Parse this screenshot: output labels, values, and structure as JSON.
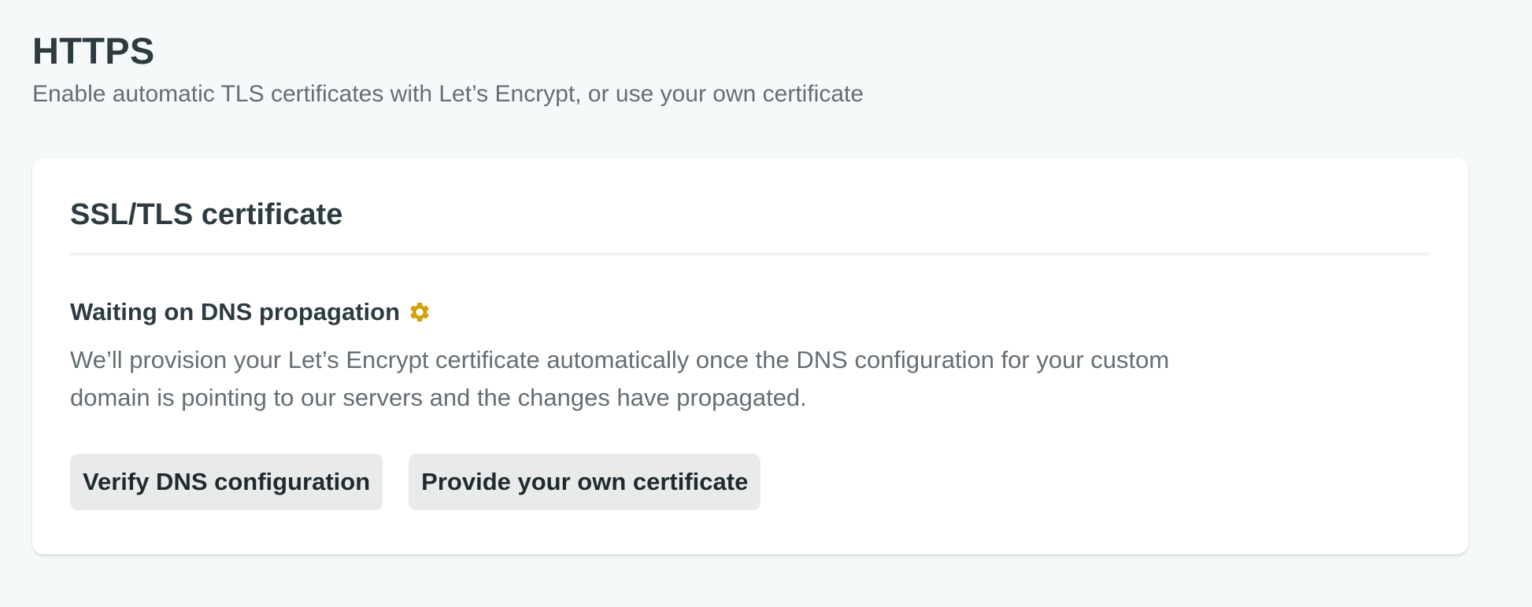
{
  "header": {
    "title": "HTTPS",
    "subtitle": "Enable automatic TLS certificates with Let’s Encrypt, or use your own certificate"
  },
  "card": {
    "title": "SSL/TLS certificate",
    "status": {
      "title": "Waiting on DNS propagation",
      "icon": "gear-icon",
      "icon_color": "#d3a10b",
      "description": "We’ll provision your Let’s Encrypt certificate automatically once the DNS configuration for your custom domain is pointing to our servers and the changes have propagated."
    },
    "actions": {
      "verify_label": "Verify DNS configuration",
      "own_cert_label": "Provide your own certificate"
    }
  }
}
